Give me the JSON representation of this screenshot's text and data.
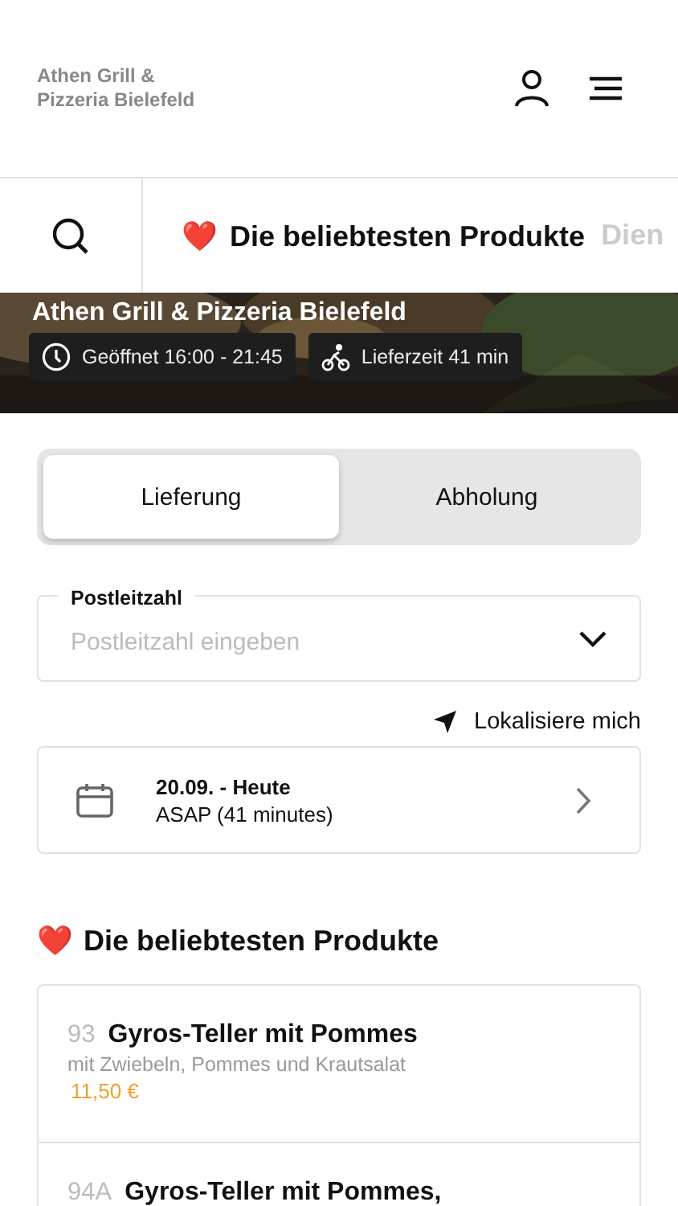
{
  "header": {
    "restaurant_name": "Athen Grill & Pizzeria Bielefeld"
  },
  "categories": [
    {
      "emoji": "❤️",
      "label": "Die beliebtesten Produkte",
      "selected": true
    },
    {
      "label": "Dien",
      "selected": false
    }
  ],
  "hero": {
    "kind": "picture",
    "title": "Athen Grill & Pizzeria Bielefeld",
    "badges": [
      {
        "kind": "clock",
        "text": "Geöffnet 16:00 - 21:45"
      },
      {
        "kind": "bike",
        "text": "Lieferzeit 41 min"
      }
    ]
  },
  "order_modes": [
    {
      "label": "Lieferung",
      "selected": true
    },
    {
      "label": "Abholung",
      "selected": false
    }
  ],
  "postcode": {
    "label": "Postleitzahl",
    "placeholder": "Postleitzahl eingeben"
  },
  "locate": "Lokalisiere mich",
  "schedule": {
    "date": "20.09. - Heute",
    "time": "ASAP (41 minutes)"
  },
  "section": {
    "emoji": "❤️",
    "title": "Die beliebtesten Produkte"
  },
  "products": [
    {
      "number": "93",
      "name": "Gyros-Teller mit Pommes",
      "description": "mit Zwiebeln, Pommes und Krautsalat",
      "price": "11,50 €"
    },
    {
      "number": "94A",
      "name": "Gyros-Teller mit Pommes,"
    }
  ]
}
